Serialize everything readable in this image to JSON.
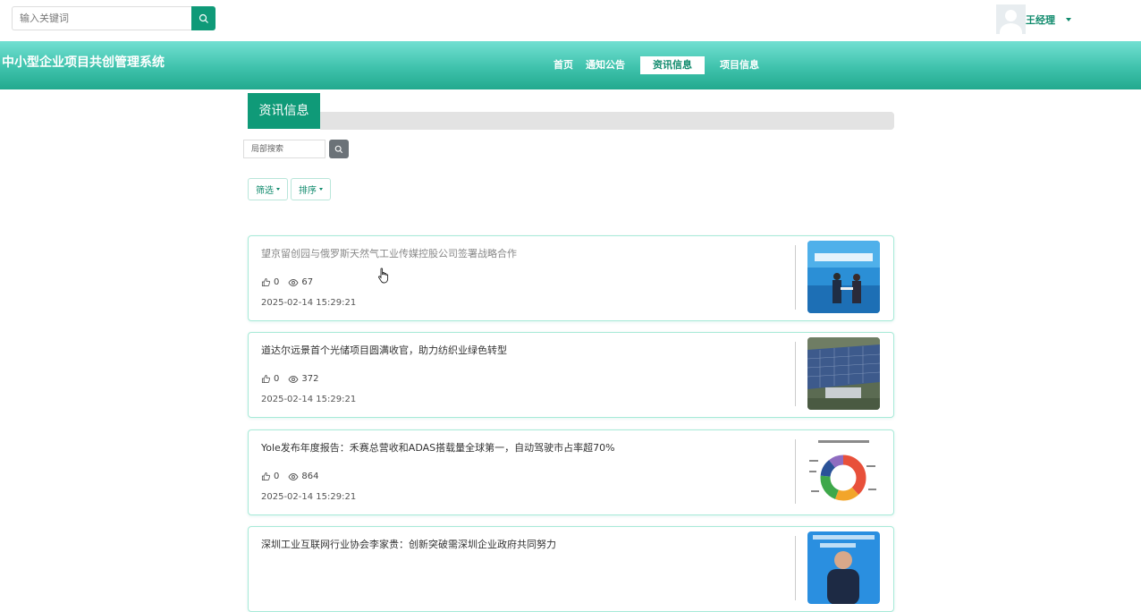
{
  "header": {
    "search_placeholder": "输入关键词",
    "username": "王经理"
  },
  "nav": {
    "system_title": "中小型企业项目共创管理系统",
    "items": [
      {
        "label": "首页",
        "active": false
      },
      {
        "label": "通知公告",
        "active": false
      },
      {
        "label": "资讯信息",
        "active": true
      },
      {
        "label": "项目信息",
        "active": false
      }
    ]
  },
  "section": {
    "title": "资讯信息",
    "local_search_placeholder": "局部搜索",
    "filter_label": "筛选",
    "sort_label": "排序"
  },
  "news": [
    {
      "title": "望京留创园与俄罗斯天然气工业传媒控股公司签署战略合作",
      "likes": "0",
      "views": "67",
      "date": "2025-02-14 15:29:21",
      "thumb": "signing-ceremony"
    },
    {
      "title": "道达尔远景首个光储项目圆满收官，助力纺织业绿色转型",
      "likes": "0",
      "views": "372",
      "date": "2025-02-14 15:29:21",
      "thumb": "solar-rooftop"
    },
    {
      "title": "Yole发布年度报告：禾赛总营收和ADAS搭载量全球第一，自动驾驶市占率超70%",
      "likes": "0",
      "views": "864",
      "date": "2025-02-14 15:29:21",
      "thumb": "donut-market-chart"
    },
    {
      "title": "深圳工业互联网行业协会李家贵：创新突破需深圳企业政府共同努力",
      "likes": "",
      "views": "",
      "date": "",
      "thumb": "speaker-portrait"
    }
  ]
}
